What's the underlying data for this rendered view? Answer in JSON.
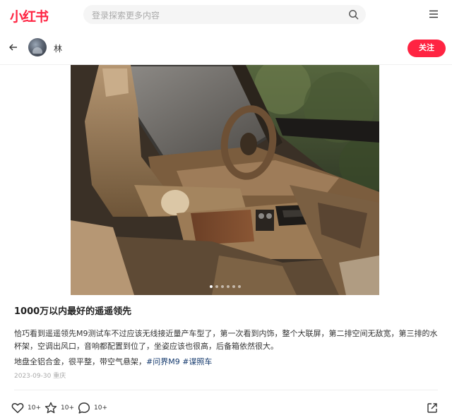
{
  "header": {
    "logo": "小红书",
    "search_placeholder": "登录探索更多内容",
    "icons": {
      "search": "search-icon",
      "menu": "menu-icon"
    }
  },
  "author": {
    "name": "林",
    "follow_label": "关注",
    "icons": {
      "back": "back-arrow-icon"
    }
  },
  "gallery": {
    "dot_count": 6,
    "active_index": 1
  },
  "note": {
    "title": "1000万以内最好的遥遥领先",
    "body": "恰巧看到遥遥领先M9测试车不过应该无线接近量产车型了，第一次看到内饰，整个大联屏，第二排空间无敌宽，第三排的水杯架，空调出风口，音响都配置到位了，坐姿应该也很高，后备箱依然很大。",
    "line2_text": "地盘全铝合金，很平整，带空气悬架，",
    "tags": [
      "#问界M9",
      "#谍照车"
    ],
    "date": "2023-09-30",
    "location": "重庆"
  },
  "actions": {
    "like_count": "10+",
    "collect_count": "10+",
    "comment_count": "10+",
    "icons": {
      "like": "heart-icon",
      "collect": "star-icon",
      "comment": "comment-icon",
      "share": "share-icon"
    }
  },
  "colors": {
    "brand": "#ff2442",
    "tag": "#13386c"
  }
}
